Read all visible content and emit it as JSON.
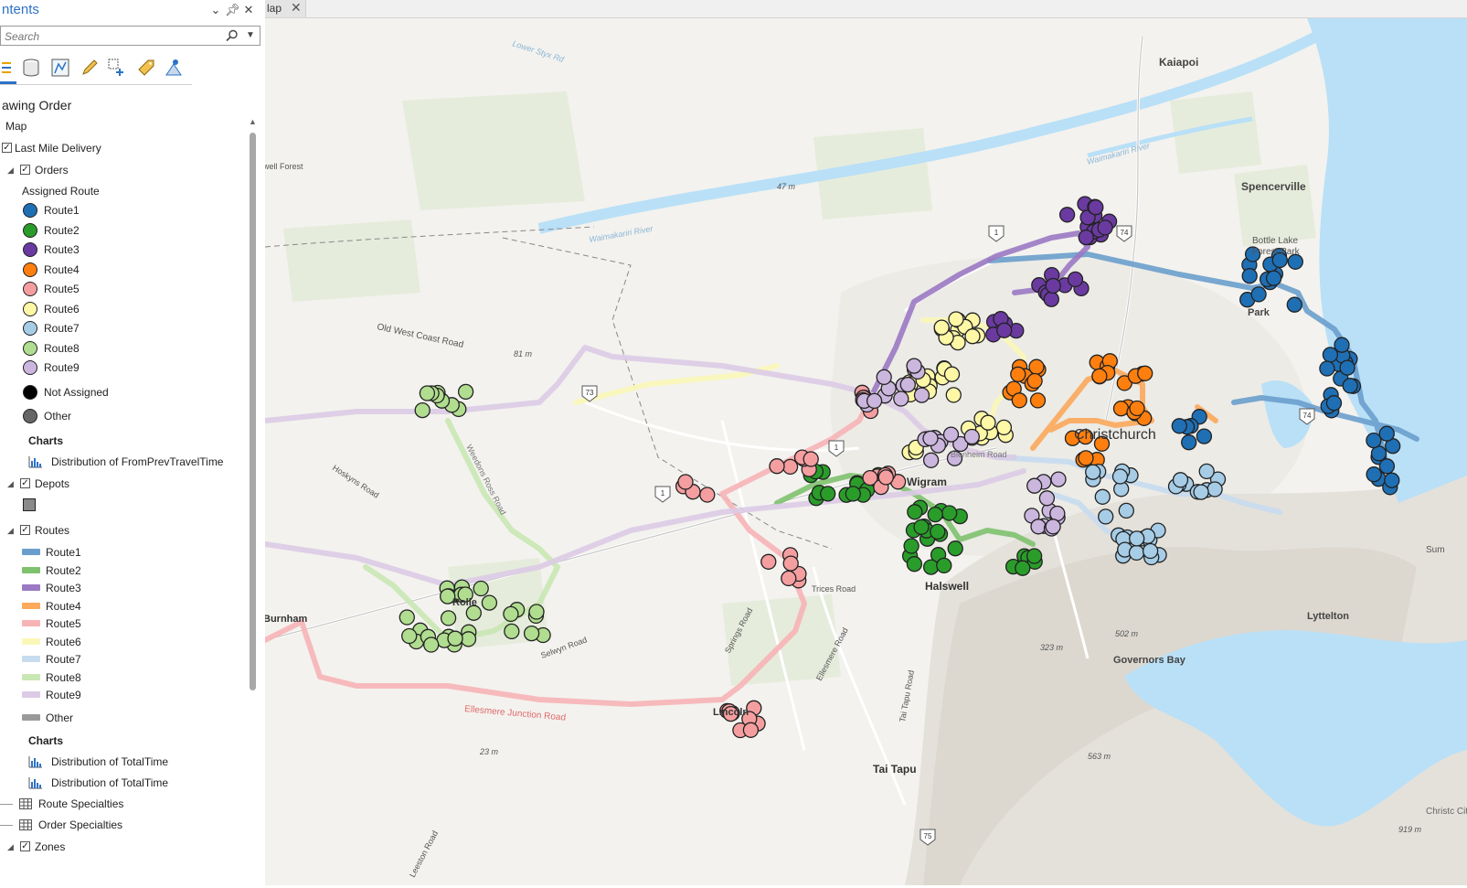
{
  "pane": {
    "title": "ntents",
    "search_placeholder": "Search",
    "section_title": "awing Order",
    "map_label": "Map",
    "group_label": "Last Mile Delivery",
    "orders": {
      "label": "Orders",
      "symbology_heading": "Assigned Route",
      "routes": [
        {
          "label": "Route1",
          "color": "#1f6fb4"
        },
        {
          "label": "Route2",
          "color": "#2a9c2a"
        },
        {
          "label": "Route3",
          "color": "#6a3aa0"
        },
        {
          "label": "Route4",
          "color": "#ff7f0e"
        },
        {
          "label": "Route5",
          "color": "#f59ea0"
        },
        {
          "label": "Route6",
          "color": "#fdf7a6"
        },
        {
          "label": "Route7",
          "color": "#a6cce6"
        },
        {
          "label": "Route8",
          "color": "#b0dd8f"
        },
        {
          "label": "Route9",
          "color": "#cbb6de"
        }
      ],
      "not_assigned": {
        "label": "Not Assigned",
        "color": "#000000"
      },
      "other": {
        "label": "Other",
        "color": "#666666"
      },
      "charts_heading": "Charts",
      "chart": "Distribution of FromPrevTravelTime"
    },
    "depots": {
      "label": "Depots"
    },
    "routes_layer": {
      "label": "Routes",
      "routes": [
        {
          "label": "Route1",
          "color": "#6a9fcc"
        },
        {
          "label": "Route2",
          "color": "#7ec26e"
        },
        {
          "label": "Route3",
          "color": "#9b79c3"
        },
        {
          "label": "Route4",
          "color": "#fca95b"
        },
        {
          "label": "Route5",
          "color": "#f7b4b6"
        },
        {
          "label": "Route6",
          "color": "#fbf7b8"
        },
        {
          "label": "Route7",
          "color": "#c7dcef"
        },
        {
          "label": "Route8",
          "color": "#c9e7b3"
        },
        {
          "label": "Route9",
          "color": "#dccbe6"
        }
      ],
      "other": {
        "label": "Other",
        "color": "#9a9a9a"
      },
      "charts_heading": "Charts",
      "charts": [
        "Distribution of TotalTime",
        "Distribution of TotalTime"
      ]
    },
    "tables": [
      "Route Specialties",
      "Order Specialties"
    ],
    "zones": {
      "label": "Zones"
    }
  },
  "map_view": {
    "tab_label": "lap",
    "close_glyph": "✕"
  },
  "map_labels": [
    {
      "text": "Kaiapoi"
    },
    {
      "text": "Spencerville"
    },
    {
      "text": "Bottle Lake"
    },
    {
      "text": "Forest Park"
    },
    {
      "text": "Park"
    },
    {
      "text": "Christchurch"
    },
    {
      "text": "Wigram"
    },
    {
      "text": "Halswell"
    },
    {
      "text": "Lyttelton"
    },
    {
      "text": "Governors Bay"
    },
    {
      "text": "Tai Tapu"
    },
    {
      "text": "Burnham"
    },
    {
      "text": "well Forest"
    },
    {
      "text": "Old West Coast Road"
    },
    {
      "text": "Hoskyns Road"
    },
    {
      "text": "Weedons Ross Road"
    },
    {
      "text": "Selwyn Road"
    },
    {
      "text": "Springs Road"
    },
    {
      "text": "Trices Road"
    },
    {
      "text": "Ellesmere Road"
    },
    {
      "text": "Tai Tapu Road"
    },
    {
      "text": "Ellesmere Junction Road"
    },
    {
      "text": "Leeston Road"
    },
    {
      "text": "Blenheim Road"
    },
    {
      "text": "Waimakariri River"
    },
    {
      "text": "Waimakariri River"
    },
    {
      "text": "Lower Styx Rd"
    },
    {
      "text": "47 m"
    },
    {
      "text": "81 m"
    },
    {
      "text": "23 m"
    },
    {
      "text": "323 m"
    },
    {
      "text": "502 m"
    },
    {
      "text": "563 m"
    },
    {
      "text": "919 m"
    },
    {
      "text": "Sum"
    },
    {
      "text": "Christc City"
    },
    {
      "text": "Rolle"
    },
    {
      "text": "Lincoln"
    }
  ],
  "shield_labels": [
    "1",
    "1",
    "1",
    "73",
    "74",
    "74",
    "75"
  ]
}
